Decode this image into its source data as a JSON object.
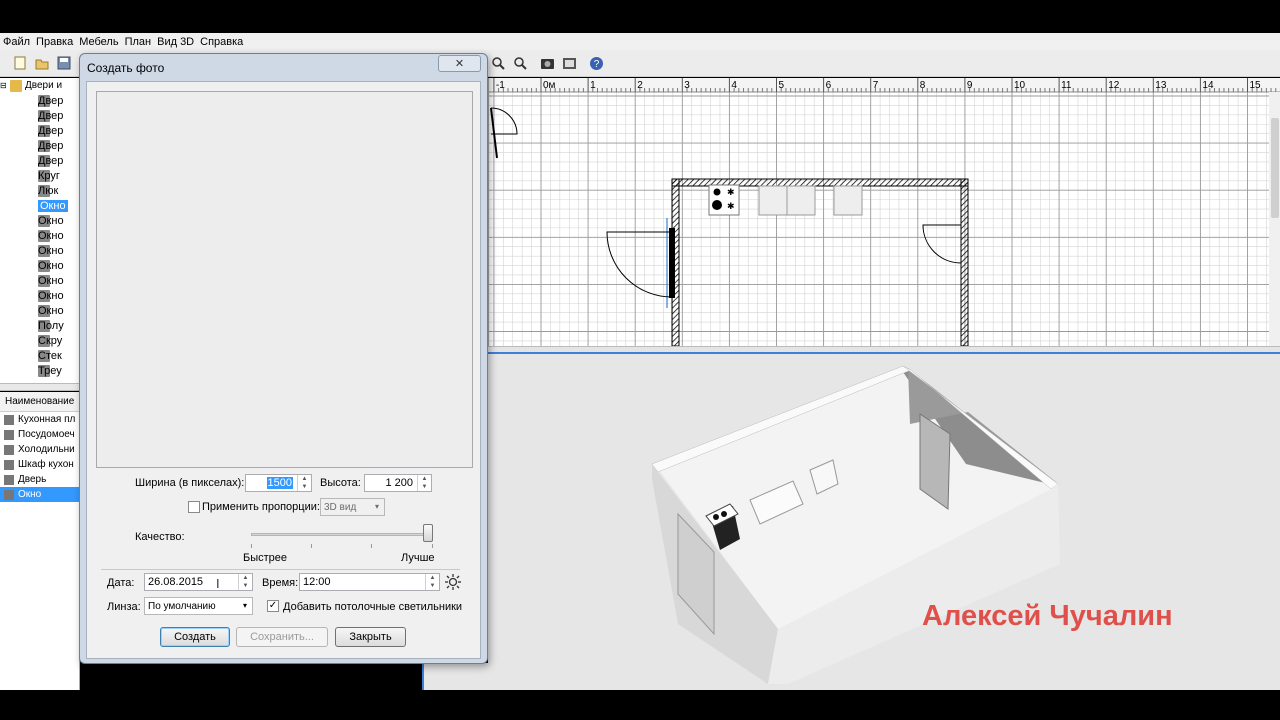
{
  "menu": [
    "Файл",
    "Правка",
    "Мебель",
    "План",
    "Вид 3D",
    "Справка"
  ],
  "toolbar_icons": [
    "new-file-icon",
    "open-folder-icon",
    "save-icon",
    "zoom-in-icon",
    "zoom-out-icon",
    "create-photo-icon",
    "create-video-icon",
    "help-icon"
  ],
  "catalog": {
    "root": "Двери и",
    "items": [
      {
        "label": "Двер",
        "icon": "door-icon"
      },
      {
        "label": "Двер",
        "icon": "door-icon"
      },
      {
        "label": "Двер",
        "icon": "door-icon"
      },
      {
        "label": "Двер",
        "icon": "door-icon"
      },
      {
        "label": "Двер",
        "icon": "door-icon"
      },
      {
        "label": "Круг",
        "icon": "round-window-icon"
      },
      {
        "label": "Люк",
        "icon": "hatch-icon"
      },
      {
        "label": "Окно",
        "icon": "window-icon",
        "selected": true
      },
      {
        "label": "Окно",
        "icon": "window-icon"
      },
      {
        "label": "Окно",
        "icon": "window-icon"
      },
      {
        "label": "Окно",
        "icon": "window-icon"
      },
      {
        "label": "Окно",
        "icon": "window-icon"
      },
      {
        "label": "Окно",
        "icon": "window-icon"
      },
      {
        "label": "Окно",
        "icon": "window-icon"
      },
      {
        "label": "Окно",
        "icon": "window-icon"
      },
      {
        "label": "Полу",
        "icon": "half-round-window-icon"
      },
      {
        "label": "Скру",
        "icon": "rounded-window-icon"
      },
      {
        "label": "Стек",
        "icon": "glass-icon"
      },
      {
        "label": "Треу",
        "icon": "triangle-window-icon"
      }
    ]
  },
  "furniture_list": {
    "header": "Наименование",
    "rows": [
      {
        "label": "Кухонная пл",
        "icon": "cooker-icon"
      },
      {
        "label": "Посудомоеч",
        "icon": "dishwasher-icon"
      },
      {
        "label": "Холодильни",
        "icon": "fridge-icon"
      },
      {
        "label": "Шкаф кухон",
        "icon": "cabinet-icon"
      },
      {
        "label": "Дверь",
        "icon": "door-icon"
      },
      {
        "label": "Окно",
        "icon": "window-icon",
        "selected": true
      }
    ]
  },
  "plan": {
    "ruler_labels": [
      "-1",
      "0м",
      "1",
      "2",
      "3",
      "4",
      "5",
      "6",
      "7",
      "8",
      "9",
      "10",
      "11",
      "12",
      "13",
      "14",
      "15"
    ]
  },
  "dialog": {
    "title": "Создать фото",
    "close_symbol": "✕",
    "width_label": "Ширина (в пикселах):",
    "width_value": "1500",
    "height_label": "Высота:",
    "height_value": "1 200",
    "proportions_label": "Применить пропорции:",
    "proportions_checked": false,
    "proportions_option": "3D вид",
    "quality_label": "Качество:",
    "quality_fast": "Быстрее",
    "quality_best": "Лучше",
    "quality_level": 1.0,
    "date_label": "Дата:",
    "date_value": "26.08.2015",
    "time_label": "Время:",
    "time_value": "12:00",
    "lens_label": "Линза:",
    "lens_value": "По умолчанию",
    "ceiling_lights_label": "Добавить потолочные светильники",
    "ceiling_lights_checked": true,
    "btn_create": "Создать",
    "btn_save": "Сохранить...",
    "btn_close": "Закрыть"
  },
  "watermark": "Алексей Чучалин",
  "colors": {
    "selection": "#3399ff",
    "watermark": "#e0504a",
    "focus_border": "#3c7fd8"
  }
}
